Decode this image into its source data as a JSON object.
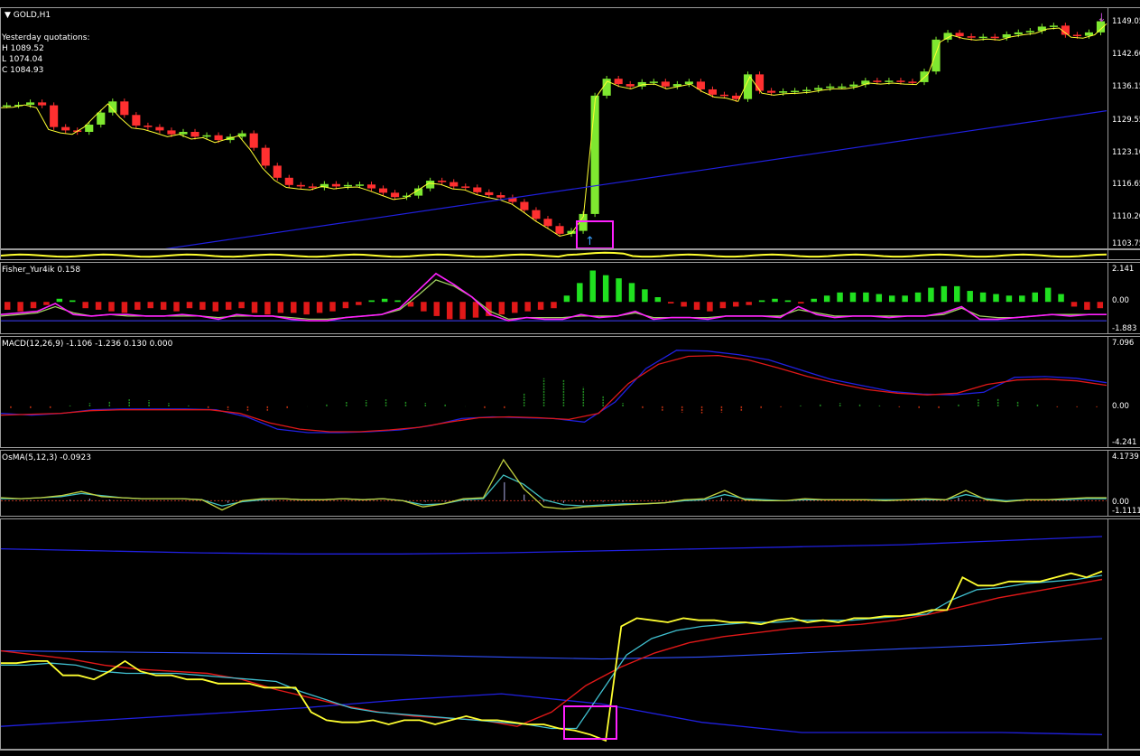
{
  "window": {
    "title": "GOLD,H1"
  },
  "info": {
    "line1": "Yesterday quotations:",
    "high": "H 1089.52",
    "low": "L 1074.04",
    "close": "C 1084.93"
  },
  "indicators": {
    "fisher": "Fisher_Yur4ik 0.158",
    "macd": "MACD(12,26,9) -1.106 -1.236 0.130 0.000",
    "osma": "OsMA(5,12,3) -0.0923"
  },
  "colors": {
    "bull": "#7fe830",
    "bear": "#ff3030",
    "yellow": "#ffff30",
    "blue": "#2020e0",
    "red": "#e01818",
    "magenta": "#ff20ff",
    "grid": "#9a9a9a"
  },
  "chart_data": [
    {
      "type": "line",
      "name": "price",
      "ticks": [
        "1149.05",
        "1142.60",
        "1136.15",
        "1129.55",
        "1123.10",
        "1116.65",
        "1110.20",
        "1103.75"
      ],
      "ylim": [
        1103.75,
        1152
      ],
      "close": [
        1133.0,
        1133.1,
        1133.6,
        1133.0,
        1128.5,
        1127.8,
        1127.5,
        1129.0,
        1131.5,
        1133.8,
        1131.0,
        1128.8,
        1128.5,
        1127.8,
        1127.0,
        1127.5,
        1126.5,
        1126.8,
        1125.8,
        1126.5,
        1127.2,
        1124.2,
        1120.5,
        1118.0,
        1116.5,
        1116.2,
        1116.0,
        1116.7,
        1116.2,
        1116.5,
        1116.6,
        1115.8,
        1114.9,
        1114.0,
        1114.3,
        1115.8,
        1117.4,
        1117.1,
        1116.2,
        1116.0,
        1115.0,
        1114.4,
        1113.9,
        1113.0,
        1111.3,
        1109.5,
        1108.0,
        1106.4,
        1107.0,
        1110.5,
        1135.0,
        1138.5,
        1137.4,
        1136.9,
        1137.8,
        1137.9,
        1136.9,
        1137.4,
        1137.9,
        1136.3,
        1135.2,
        1135.0,
        1134.3,
        1139.4,
        1136.0,
        1135.6,
        1135.9,
        1136.0,
        1136.2,
        1136.6,
        1136.9,
        1136.9,
        1137.3,
        1138.1,
        1137.9,
        1138.1,
        1137.9,
        1137.8,
        1140.0,
        1146.6,
        1148.0,
        1147.3,
        1147.0,
        1147.2,
        1147.0,
        1147.7,
        1148.1,
        1148.4,
        1149.3,
        1149.5,
        1147.6,
        1147.4,
        1148.1,
        1150.4
      ],
      "ma": [
        1108,
        1130
      ]
    },
    {
      "type": "bar",
      "name": "fisher",
      "ticks": [
        "2.141",
        "0.00",
        "-1.883"
      ],
      "ylim": [
        -1.883,
        2.141
      ],
      "values": [
        -0.5,
        -0.6,
        -0.4,
        -0.2,
        0.2,
        0.1,
        -0.4,
        -0.5,
        -0.6,
        -0.7,
        -0.5,
        -0.4,
        -0.5,
        -0.6,
        -0.4,
        -0.5,
        -0.6,
        -0.5,
        -0.4,
        -0.7,
        -0.8,
        -0.7,
        -0.7,
        -0.8,
        -0.7,
        -0.6,
        -0.4,
        -0.2,
        0.1,
        0.2,
        0.1,
        -0.3,
        -0.6,
        -0.9,
        -1.1,
        -1.1,
        -1.0,
        -0.9,
        -0.8,
        -0.7,
        -0.6,
        -0.5,
        -0.4,
        0.4,
        1.2,
        2.0,
        1.7,
        1.5,
        1.2,
        0.8,
        0.3,
        -0.1,
        -0.3,
        -0.5,
        -0.6,
        -0.4,
        -0.3,
        -0.2,
        0.1,
        0.2,
        0.1,
        -0.1,
        0.2,
        0.4,
        0.6,
        0.6,
        0.6,
        0.5,
        0.4,
        0.4,
        0.6,
        0.9,
        1.0,
        1.0,
        0.7,
        0.6,
        0.5,
        0.4,
        0.4,
        0.6,
        0.9,
        0.5,
        -0.3,
        -0.5,
        -0.4
      ],
      "fast": [
        -0.8,
        -0.7,
        -0.6,
        -0.1,
        -0.8,
        -0.9,
        -0.8,
        -0.8,
        -0.9,
        -0.9,
        -0.8,
        -0.9,
        -1.1,
        -0.8,
        -0.9,
        -0.9,
        -1.1,
        -1.2,
        -1.2,
        -1.0,
        -0.9,
        -0.8,
        -0.4,
        0.7,
        1.8,
        1.1,
        0.3,
        -0.8,
        -1.2,
        -1.0,
        -1.1,
        -1.1,
        -0.8,
        -1.0,
        -0.9,
        -0.6,
        -1.1,
        -1.0,
        -1.0,
        -1.1,
        -0.9,
        -0.9,
        -0.9,
        -1.0,
        -0.3,
        -0.8,
        -1.0,
        -0.9,
        -0.9,
        -1.0,
        -0.9,
        -0.9,
        -0.7,
        -0.3,
        -1.1,
        -1.1,
        -1.0,
        -0.9,
        -0.8,
        -0.9,
        -0.8,
        -0.8
      ],
      "slow": [
        -0.9,
        -0.8,
        -0.7,
        -0.3,
        -0.7,
        -0.9,
        -0.8,
        -0.9,
        -0.9,
        -0.9,
        -0.9,
        -0.9,
        -1.0,
        -0.9,
        -0.9,
        -0.9,
        -1.0,
        -1.1,
        -1.1,
        -1.0,
        -0.9,
        -0.8,
        -0.5,
        0.4,
        1.4,
        1.0,
        0.3,
        -0.6,
        -1.1,
        -1.0,
        -1.0,
        -1.0,
        -0.9,
        -0.9,
        -0.9,
        -0.7,
        -1.0,
        -1.0,
        -1.0,
        -1.0,
        -0.9,
        -0.9,
        -0.9,
        -0.9,
        -0.5,
        -0.7,
        -0.9,
        -0.9,
        -0.9,
        -0.9,
        -0.9,
        -0.9,
        -0.8,
        -0.4,
        -0.9,
        -1.0,
        -1.0,
        -0.9,
        -0.8,
        -0.8,
        -0.8,
        -0.8
      ]
    },
    {
      "type": "line",
      "name": "macd",
      "ticks": [
        "7.096",
        "0.00",
        "-4.241"
      ],
      "ylim": [
        -4.241,
        7.096
      ],
      "hist": [
        -0.2,
        -0.3,
        -0.2,
        0.1,
        0.4,
        0.6,
        0.8,
        0.7,
        0.4,
        0.1,
        -0.2,
        -0.4,
        -0.5,
        -0.5,
        -0.3,
        0.0,
        0.3,
        0.5,
        0.7,
        0.8,
        0.6,
        0.4,
        0.2,
        0.0,
        -0.2,
        -0.3,
        1.5,
        3.2,
        3.0,
        2.2,
        1.2,
        0.4,
        -0.2,
        -0.5,
        -0.7,
        -0.8,
        -0.7,
        -0.5,
        -0.3,
        -0.1,
        0.1,
        0.3,
        0.4,
        0.3,
        0.1,
        -0.1,
        -0.2,
        -0.3,
        0.2,
        0.8,
        0.9,
        0.6,
        0.2,
        -0.1,
        -0.1,
        -0.1
      ],
      "macd": [
        -0.8,
        -1.0,
        -0.8,
        -0.4,
        -0.3,
        -0.3,
        -0.3,
        -0.4,
        -1.2,
        -2.6,
        -3.0,
        -3.0,
        -2.9,
        -2.7,
        -2.2,
        -1.4,
        -1.2,
        -1.3,
        -1.4,
        -1.8,
        0.5,
        4.3,
        6.4,
        6.3,
        5.9,
        5.3,
        4.2,
        3.1,
        2.4,
        1.7,
        1.4,
        1.3,
        1.6,
        3.3,
        3.4,
        3.2,
        2.7
      ],
      "signal": [
        -1.0,
        -0.9,
        -0.8,
        -0.5,
        -0.4,
        -0.4,
        -0.4,
        -0.4,
        -0.8,
        -1.9,
        -2.6,
        -2.9,
        -2.9,
        -2.7,
        -2.4,
        -1.8,
        -1.3,
        -1.2,
        -1.3,
        -1.5,
        -0.8,
        2.6,
        4.8,
        5.7,
        5.8,
        5.3,
        4.4,
        3.4,
        2.6,
        1.9,
        1.5,
        1.3,
        1.5,
        2.5,
        3.0,
        3.1,
        2.9,
        2.4
      ]
    },
    {
      "type": "line",
      "name": "osma",
      "ticks": [
        "4.1739",
        "0.00",
        "-1.1111"
      ],
      "ylim": [
        -1.1111,
        4.1739
      ],
      "fast": [
        0.3,
        0.2,
        0.3,
        0.5,
        0.9,
        0.4,
        0.3,
        0.2,
        0.2,
        0.2,
        0.1,
        -0.9,
        0.0,
        0.2,
        0.2,
        0.1,
        0.1,
        0.2,
        0.1,
        0.2,
        0.0,
        -0.6,
        -0.3,
        0.2,
        0.3,
        4.0,
        1.2,
        -0.6,
        -0.8,
        -0.6,
        -0.5,
        -0.4,
        -0.3,
        -0.2,
        0.1,
        0.2,
        1.0,
        0.1,
        0.0,
        0.0,
        0.2,
        0.1,
        0.1,
        0.1,
        0.0,
        0.1,
        0.2,
        0.1,
        1.0,
        0.1,
        -0.1,
        0.1,
        0.1,
        0.2,
        0.3,
        0.3
      ],
      "slow": [
        0.2,
        0.2,
        0.3,
        0.4,
        0.7,
        0.5,
        0.3,
        0.2,
        0.2,
        0.2,
        0.1,
        -0.5,
        -0.1,
        0.1,
        0.2,
        0.1,
        0.1,
        0.2,
        0.1,
        0.2,
        0.0,
        -0.4,
        -0.3,
        0.1,
        0.2,
        2.5,
        1.6,
        0.1,
        -0.4,
        -0.5,
        -0.4,
        -0.3,
        -0.3,
        -0.2,
        0.0,
        0.1,
        0.6,
        0.2,
        0.1,
        0.0,
        0.1,
        0.1,
        0.1,
        0.1,
        0.1,
        0.1,
        0.1,
        0.1,
        0.6,
        0.2,
        0.0,
        0.1,
        0.1,
        0.1,
        0.2,
        0.2
      ],
      "hist": [
        0.0,
        0.05,
        0.0,
        0.1,
        0.2,
        0.1,
        0.0,
        0.0,
        0.0,
        0.0,
        0.0,
        -0.2,
        0.0,
        0.0,
        0.0,
        0.0,
        0.0,
        0.0,
        0.0,
        0.0,
        0.0,
        -0.1,
        -0.1,
        0.0,
        0.0,
        1.8,
        0.6,
        -0.1,
        -0.2,
        -0.2,
        -0.1,
        -0.1,
        0.0,
        0.0,
        0.0,
        0.0,
        0.3,
        0.0,
        0.0,
        0.0,
        0.0,
        0.0,
        0.0,
        0.0,
        0.0,
        0.0,
        0.0,
        0.0,
        0.3,
        0.0,
        0.0,
        0.0,
        0.0,
        0.0,
        0.0,
        0.0
      ]
    },
    {
      "type": "line",
      "name": "moving-averages",
      "price": [
        0.34,
        0.34,
        0.35,
        0.35,
        0.28,
        0.28,
        0.26,
        0.3,
        0.35,
        0.3,
        0.28,
        0.28,
        0.26,
        0.26,
        0.24,
        0.24,
        0.24,
        0.22,
        0.22,
        0.22,
        0.1,
        0.06,
        0.05,
        0.05,
        0.06,
        0.04,
        0.06,
        0.06,
        0.04,
        0.06,
        0.08,
        0.06,
        0.06,
        0.05,
        0.04,
        0.04,
        0.02,
        0.01,
        -0.01,
        -0.04,
        0.52,
        0.56,
        0.55,
        0.54,
        0.56,
        0.55,
        0.55,
        0.54,
        0.54,
        0.53,
        0.55,
        0.56,
        0.54,
        0.55,
        0.54,
        0.56,
        0.56,
        0.57,
        0.57,
        0.58,
        0.6,
        0.6,
        0.76,
        0.72,
        0.72,
        0.74,
        0.74,
        0.74,
        0.76,
        0.78,
        0.76,
        0.79
      ],
      "fast": [
        0.33,
        0.33,
        0.34,
        0.33,
        0.3,
        0.29,
        0.29,
        0.29,
        0.28,
        0.27,
        0.26,
        0.25,
        0.2,
        0.16,
        0.12,
        0.1,
        0.09,
        0.08,
        0.07,
        0.06,
        0.05,
        0.04,
        0.02,
        0.02,
        0.2,
        0.38,
        0.46,
        0.5,
        0.52,
        0.53,
        0.54,
        0.54,
        0.55,
        0.55,
        0.55,
        0.56,
        0.57,
        0.58,
        0.65,
        0.7,
        0.71,
        0.73,
        0.74,
        0.75,
        0.77
      ],
      "red": [
        0.4,
        0.38,
        0.36,
        0.33,
        0.31,
        0.3,
        0.29,
        0.26,
        0.21,
        0.17,
        0.13,
        0.1,
        0.08,
        0.07,
        0.06,
        0.03,
        0.1,
        0.23,
        0.32,
        0.39,
        0.44,
        0.47,
        0.49,
        0.51,
        0.52,
        0.53,
        0.55,
        0.58,
        0.62,
        0.66,
        0.69,
        0.72,
        0.75
      ],
      "band_top": [
        0.9,
        0.89,
        0.88,
        0.875,
        0.875,
        0.88,
        0.89,
        0.9,
        0.91,
        0.92,
        0.94,
        0.96
      ],
      "band_mid": [
        0.4,
        0.395,
        0.39,
        0.385,
        0.38,
        0.37,
        0.36,
        0.37,
        0.39,
        0.41,
        0.43,
        0.46
      ],
      "band_bot": [
        0.03,
        0.06,
        0.09,
        0.12,
        0.16,
        0.19,
        0.14,
        0.05,
        0.0,
        0.0,
        0.0,
        -0.01
      ]
    }
  ]
}
